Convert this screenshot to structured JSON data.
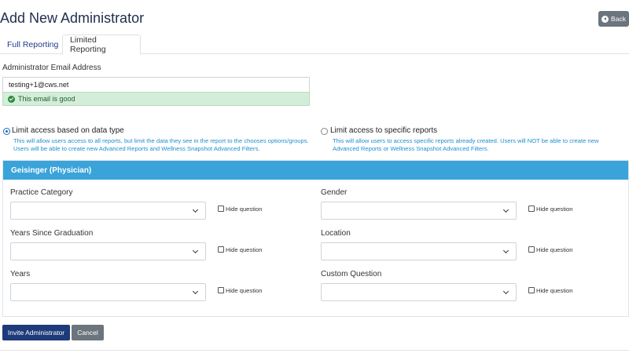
{
  "page": {
    "title": "Add New Administrator",
    "back_label": "Back"
  },
  "tabs": [
    {
      "label": "Full Reporting",
      "active": false
    },
    {
      "label": "Limited Reporting",
      "active": true
    }
  ],
  "email": {
    "label": "Administrator Email Address",
    "value": "testing+1@cws.net",
    "validation": "This email is good"
  },
  "access": {
    "option_data_type": {
      "label": "Limit access based on data type",
      "help": "This will allow users access to all reports, but limit the data they see in the report to the chooses options/groups. Users will be able to create new Advanced Reports and Wellness Snapshot Advanced Filters.",
      "selected": true
    },
    "option_reports": {
      "label": "Limit access to specific reports",
      "help": "This will allow users to access specific reports already created. Users will NOT be able to create new Advanced Reports or Wellness Snapshot Advanced Filters.",
      "selected": false
    }
  },
  "panel": {
    "title": "Geisinger (Physician)",
    "hide_label": "Hide question",
    "questions": [
      {
        "label": "Practice Category",
        "value": ""
      },
      {
        "label": "Gender",
        "value": ""
      },
      {
        "label": "Years Since Graduation",
        "value": ""
      },
      {
        "label": "Location",
        "value": ""
      },
      {
        "label": "Years",
        "value": ""
      },
      {
        "label": "Custom Question",
        "value": ""
      }
    ]
  },
  "actions": {
    "invite_label": "Invite Administrator",
    "cancel_label": "Cancel"
  },
  "colors": {
    "primary": "#1d3a7a",
    "panel_header": "#3aa3da",
    "help_text": "#1e8fd0",
    "success_bg": "#d4edda"
  }
}
